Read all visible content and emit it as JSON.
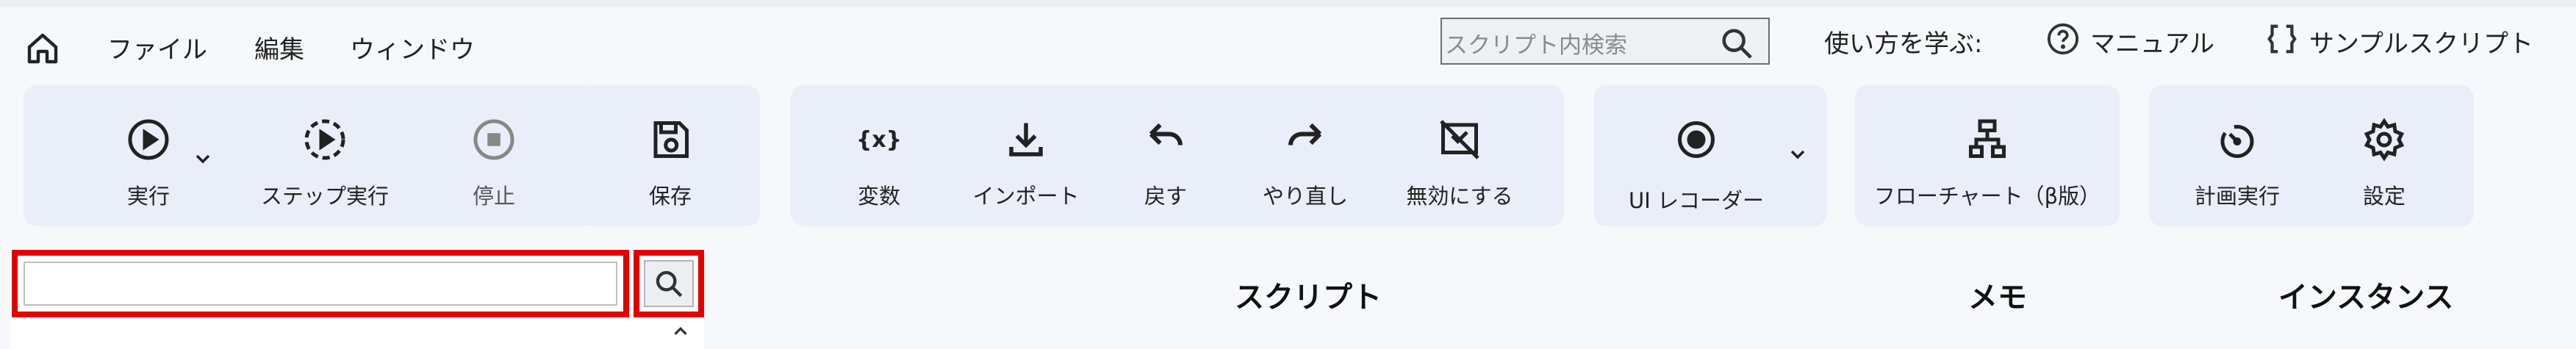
{
  "menu": {
    "file": "ファイル",
    "edit": "編集",
    "window": "ウィンドウ"
  },
  "search": {
    "placeholder": "スクリプト内検索"
  },
  "help": {
    "learn": "使い方を学ぶ:",
    "manual": "マニュアル",
    "samples": "サンプルスクリプト"
  },
  "toolbar": {
    "run": "実行",
    "step_run": "ステップ実行",
    "stop": "停止",
    "save": "保存",
    "variables": "変数",
    "import": "インポート",
    "undo": "戻す",
    "redo": "やり直し",
    "disable": "無効にする",
    "ui_recorder": "UI レコーダー",
    "flowchart": "フローチャート（β版）",
    "scheduled_run": "計画実行",
    "settings": "設定"
  },
  "table": {
    "col_script": "スクリプト",
    "col_memo": "メモ",
    "col_instance": "インスタンス"
  },
  "colors": {
    "accent_red": "#e30000",
    "panel": "#e9eef8"
  }
}
